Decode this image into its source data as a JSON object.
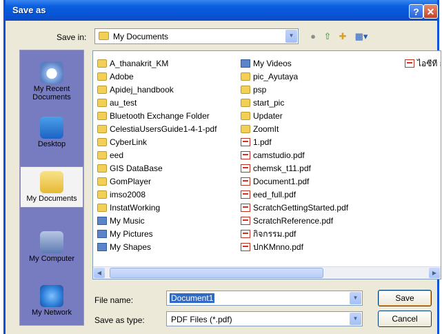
{
  "window": {
    "title": "Save as"
  },
  "toolbar": {
    "save_in_label": "Save in:",
    "save_in_value": "My Documents",
    "icons": [
      "back-icon",
      "up-folder-icon",
      "new-folder-icon",
      "view-menu-icon"
    ]
  },
  "places": [
    {
      "line1": "My Recent",
      "line2": "Documents",
      "icon": "recent-documents-icon"
    },
    {
      "line1": "Desktop",
      "line2": "",
      "icon": "desktop-icon"
    },
    {
      "line1": "My Documents",
      "line2": "",
      "icon": "my-documents-icon"
    },
    {
      "line1": "My Computer",
      "line2": "",
      "icon": "my-computer-icon"
    },
    {
      "line1": "My Network",
      "line2": "",
      "icon": "my-network-icon"
    }
  ],
  "files": {
    "column1": [
      "A_thanakrit_KM",
      "Adobe",
      "Apidej_handbook",
      "au_test",
      "Bluetooth Exchange Folder",
      "CelestiaUsersGuide1-4-1-pdf",
      "CyberLink",
      "eed",
      "GIS DataBase",
      "GomPlayer",
      "imso2008",
      "InstatWorking",
      "My Music",
      "My Pictures",
      "My Shapes"
    ],
    "column2": [
      "My Videos",
      "pic_Ayutaya",
      "psp",
      "start_pic",
      "Updater",
      "ZoomIt",
      "1.pdf",
      "camstudio.pdf",
      "chemsk_t11.pdf",
      "Document1.pdf",
      "eed_full.pdf",
      "ScratchGettingStarted.pdf",
      "ScratchReference.pdf",
      "กิจกรรม.pdf",
      "ปกKMnno.pdf"
    ],
    "column3": [
      "ไอซีที กับ ก"
    ]
  },
  "filename": {
    "label": "File name:",
    "value": "Document1"
  },
  "filetype": {
    "label": "Save as type:",
    "value": "PDF Files (*.pdf)"
  },
  "buttons": {
    "save": "Save",
    "cancel": "Cancel"
  }
}
